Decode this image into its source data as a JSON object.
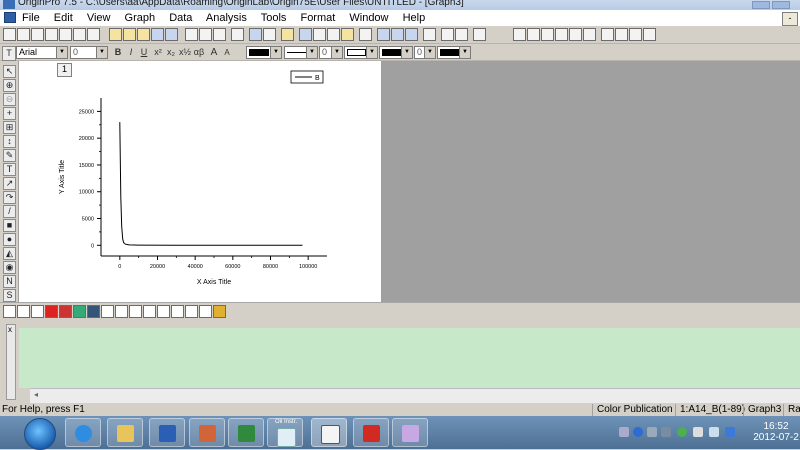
{
  "window": {
    "title": "OriginPro 7.5 - C:\\Users\\aa\\AppData\\Roaming\\OriginLab\\Origin75E\\User Files\\UNTITLED - [Graph3]"
  },
  "menu": {
    "items": [
      "File",
      "Edit",
      "View",
      "Graph",
      "Data",
      "Analysis",
      "Tools",
      "Format",
      "Window",
      "Help"
    ],
    "restore_glyph": "-"
  },
  "format_toolbar": {
    "font_name": "Arial",
    "font_size": "0",
    "bold": "B",
    "italic": "I",
    "underline": "U",
    "superscript": "x²",
    "subscript": "x₂",
    "greek": "αβ",
    "larger": "A",
    "smaller": "A",
    "line_width_1": "0",
    "line_width_2": "0"
  },
  "graph": {
    "layer_label": "1",
    "legend_label": "B"
  },
  "chart_data": {
    "type": "line",
    "xlabel": "X Axis Title",
    "ylabel": "Y Axis Title",
    "xlim": [
      -10000,
      110000
    ],
    "ylim": [
      -2000,
      27500
    ],
    "x_ticks": [
      "0",
      "20000",
      "40000",
      "60000",
      "80000",
      "100000"
    ],
    "x_tick_values": [
      0,
      20000,
      40000,
      60000,
      80000,
      100000
    ],
    "y_ticks": [
      "0",
      "5000",
      "10000",
      "15000",
      "20000",
      "25000"
    ],
    "y_tick_values": [
      0,
      5000,
      10000,
      15000,
      20000,
      25000
    ],
    "grid": false,
    "legend_position": "top-right",
    "series": [
      {
        "name": "B",
        "color": "#000000",
        "x": [
          0,
          500,
          1000,
          1500,
          2000,
          3000,
          5000,
          10000,
          30000,
          60000,
          97000
        ],
        "y": [
          23000,
          9000,
          3500,
          1200,
          500,
          200,
          80,
          30,
          10,
          5,
          5
        ]
      }
    ]
  },
  "script_window": {
    "marker": "x"
  },
  "statusbar": {
    "help": "For Help, press F1",
    "theme": "Color Publication",
    "range": "1:A14_B(1-89)",
    "window": "Graph3",
    "angle": "Rac"
  },
  "taskbar": {
    "apps": [
      "internet-explorer",
      "windows-explorer",
      "word",
      "powerpoint",
      "excel",
      "oil-instrument",
      "origin",
      "adobe-reader",
      "paint"
    ],
    "oil_label": "Oil Instr.",
    "time": "16:52",
    "date": "2012-07-2"
  }
}
